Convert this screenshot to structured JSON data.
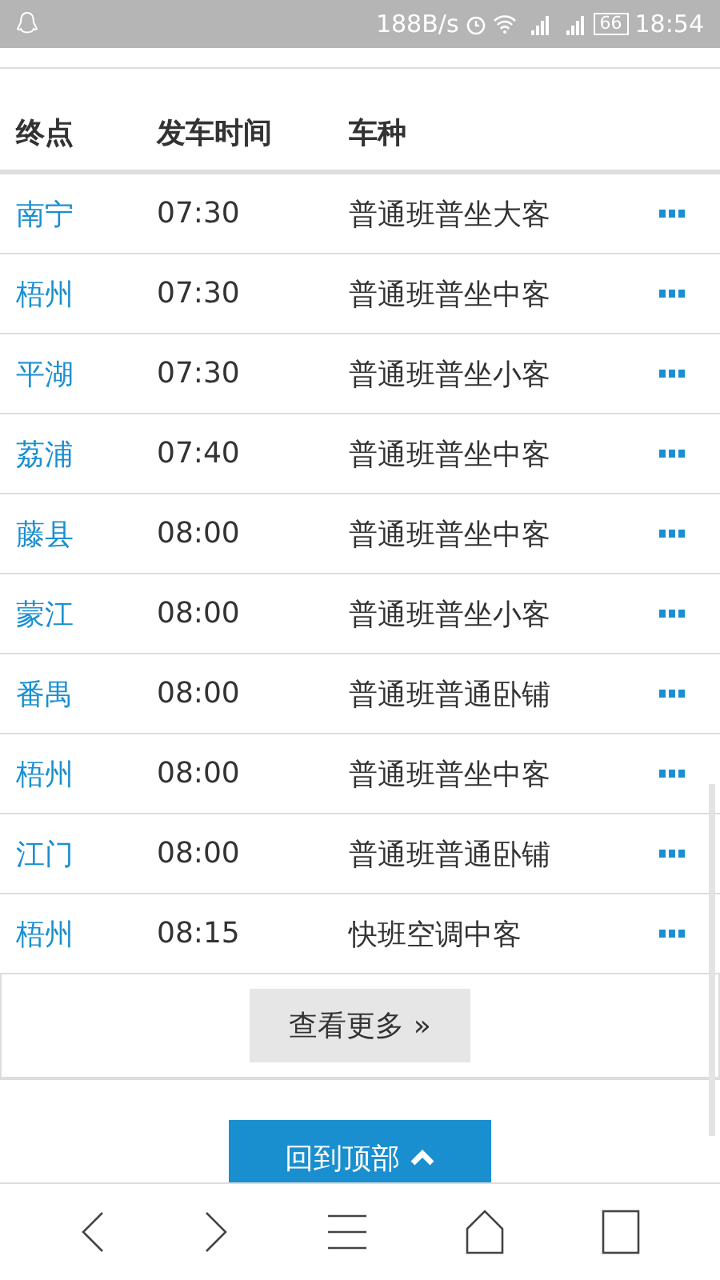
{
  "status_bar": {
    "speed": "188B/s",
    "battery": "66",
    "time": "18:54"
  },
  "table": {
    "columns": [
      "终点",
      "发车时间",
      "车种"
    ],
    "rows": [
      {
        "destination": "南宁",
        "time": "07:30",
        "type": "普通班普坐大客"
      },
      {
        "destination": "梧州",
        "time": "07:30",
        "type": "普通班普坐中客"
      },
      {
        "destination": "平湖",
        "time": "07:30",
        "type": "普通班普坐小客"
      },
      {
        "destination": "荔浦",
        "time": "07:40",
        "type": "普通班普坐中客"
      },
      {
        "destination": "藤县",
        "time": "08:00",
        "type": "普通班普坐中客"
      },
      {
        "destination": "蒙江",
        "time": "08:00",
        "type": "普通班普坐小客"
      },
      {
        "destination": "番禺",
        "time": "08:00",
        "type": "普通班普通卧铺"
      },
      {
        "destination": "梧州",
        "time": "08:00",
        "type": "普通班普坐中客"
      },
      {
        "destination": "江门",
        "time": "08:00",
        "type": "普通班普通卧铺"
      },
      {
        "destination": "梧州",
        "time": "08:15",
        "type": "快班空调中客"
      }
    ]
  },
  "more_button": "查看更多 »",
  "back_to_top": "回到顶部"
}
